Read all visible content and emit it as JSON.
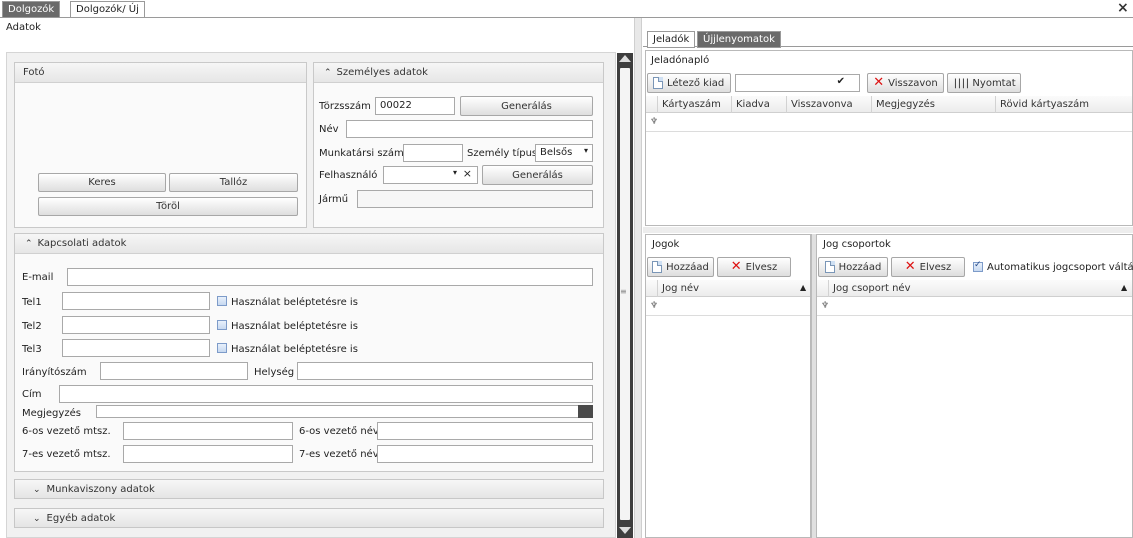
{
  "doc_tabs": [
    "Dolgozók",
    "Dolgozók/ Új"
  ],
  "close_glyph": "×",
  "left": {
    "section_title": "Adatok",
    "photo": {
      "title": "Fotó",
      "search_btn": "Keres",
      "browse_btn": "Tallóz",
      "delete_btn": "Töröl"
    },
    "personal": {
      "title": "Személyes adatok",
      "torzsszam_label": "Törzsszám",
      "torzsszam_value": "00022",
      "generate_btn": "Generálás",
      "name_label": "Név",
      "name_value": "",
      "colleague_no_label": "Munkatársi szám",
      "colleague_no_value": "",
      "person_type_label": "Személy típus",
      "person_type_value": "Belsős",
      "user_label": "Felhasználó",
      "user_value": "",
      "generate_btn2": "Generálás",
      "vehicle_label": "Jármű",
      "vehicle_value": ""
    },
    "contact": {
      "title": "Kapcsolati adatok",
      "email_label": "E-mail",
      "email_value": "",
      "tel1_label": "Tel1",
      "tel2_label": "Tel2",
      "tel3_label": "Tel3",
      "tel1_value": "",
      "tel2_value": "",
      "tel3_value": "",
      "use_for_entry": "Használat beléptetésre is",
      "zip_label": "Irányítószám",
      "zip_value": "",
      "city_label": "Helység",
      "city_value": "",
      "address_label": "Cím",
      "address_value": "",
      "note_label": "Megjegyzés",
      "note_value": "",
      "mgr6_no_label": "6-os vezető mtsz.",
      "mgr6_name_label": "6-os vezető név",
      "mgr7_no_label": "7-es vezető mtsz.",
      "mgr7_name_label": "7-es vezető név",
      "mgr6_no_value": "",
      "mgr6_name_value": "",
      "mgr7_no_value": "",
      "mgr7_name_value": ""
    },
    "employment_title": "Munkaviszony adatok",
    "other_title": "Egyéb adatok"
  },
  "right": {
    "tabs": [
      "Jeladók",
      "Újjlenyomatok"
    ],
    "log": {
      "title": "Jeladónapló",
      "issue_existing_btn": "Létező kiad",
      "combo_value": "",
      "revoke_btn": "Visszavon",
      "print_btn": "Nyomtat",
      "columns": [
        "Kártyaszám",
        "Kiadva",
        "Visszavonva",
        "Megjegyzés",
        "Rövid kártyaszám"
      ]
    },
    "rights": {
      "title": "Jogok",
      "add_btn": "Hozzáad",
      "remove_btn": "Elvesz",
      "column": "Jog név"
    },
    "groups": {
      "title": "Jog csoportok",
      "add_btn": "Hozzáad",
      "remove_btn": "Elvesz",
      "auto_switch_label": "Automatikus jogcsoport váltás",
      "auto_switch_checked": true,
      "column": "Jog csoport név"
    }
  },
  "colors": {
    "tab_active": "#ffffff",
    "tab_inactive": "#6f6f6f",
    "accent_red": "#d11111"
  }
}
